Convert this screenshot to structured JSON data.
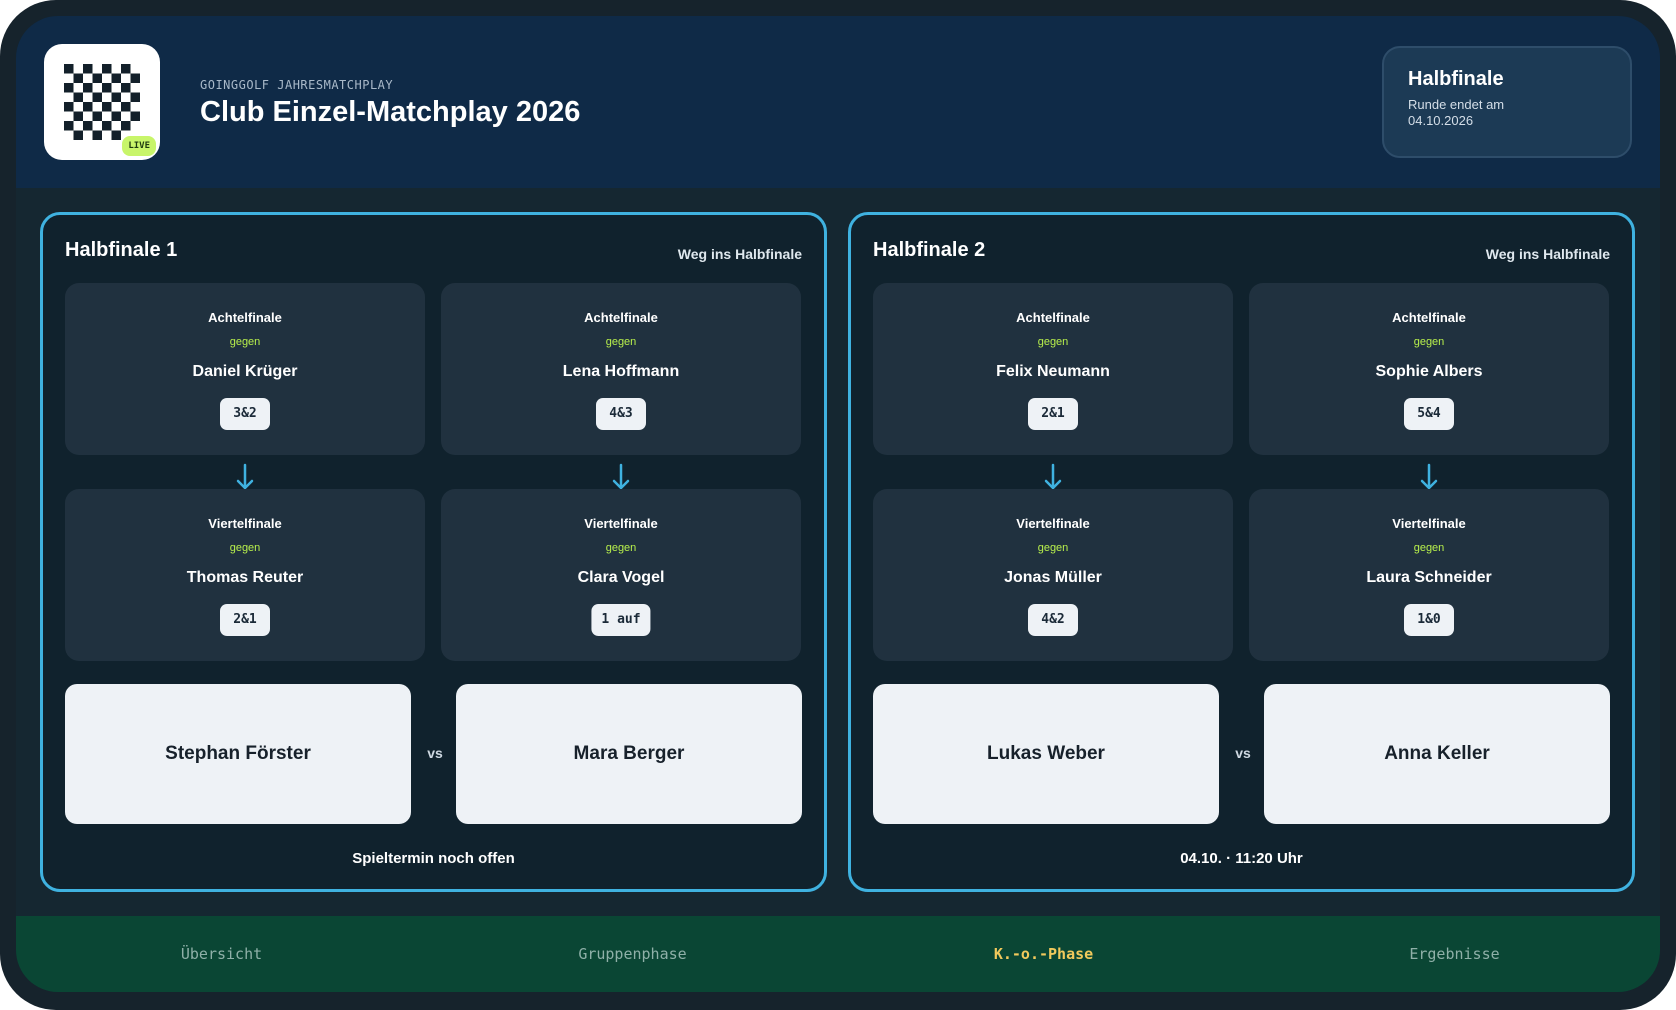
{
  "header": {
    "eyebrow": "GOINGGOLF JAHRESMATCHPLAY",
    "title": "Club Einzel-Matchplay 2026",
    "live_badge": "LIVE",
    "round": {
      "title": "Halbfinale",
      "subtitle": "Runde endet am 04.10.2026"
    }
  },
  "panels": [
    {
      "title": "Halbfinale 1",
      "subtitle": "Weg ins Halbfinale",
      "matches": [
        {
          "stage": "Achtelfinale",
          "vs_word": "gegen",
          "opponent": "Daniel Krüger",
          "score": "3&2"
        },
        {
          "stage": "Achtelfinale",
          "vs_word": "gegen",
          "opponent": "Lena Hoffmann",
          "score": "4&3"
        },
        {
          "stage": "Viertelfinale",
          "vs_word": "gegen",
          "opponent": "Thomas Reuter",
          "score": "2&1"
        },
        {
          "stage": "Viertelfinale",
          "vs_word": "gegen",
          "opponent": "Clara Vogel",
          "score": "1 auf"
        }
      ],
      "player_left": "Stephan Förster",
      "versus": "vs",
      "player_right": "Mara Berger",
      "schedule": "Spieltermin noch offen"
    },
    {
      "title": "Halbfinale 2",
      "subtitle": "Weg ins Halbfinale",
      "matches": [
        {
          "stage": "Achtelfinale",
          "vs_word": "gegen",
          "opponent": "Felix Neumann",
          "score": "2&1"
        },
        {
          "stage": "Achtelfinale",
          "vs_word": "gegen",
          "opponent": "Sophie Albers",
          "score": "5&4"
        },
        {
          "stage": "Viertelfinale",
          "vs_word": "gegen",
          "opponent": "Jonas Müller",
          "score": "4&2"
        },
        {
          "stage": "Viertelfinale",
          "vs_word": "gegen",
          "opponent": "Laura Schneider",
          "score": "1&0"
        }
      ],
      "player_left": "Lukas Weber",
      "versus": "vs",
      "player_right": "Anna Keller",
      "schedule": "04.10. · 11:20 Uhr"
    }
  ],
  "nav": {
    "items": [
      {
        "label": "Übersicht"
      },
      {
        "label": "Gruppenphase"
      },
      {
        "label": "K.-o.-Phase"
      },
      {
        "label": "Ergebnisse"
      }
    ],
    "active": "K.-o.-Phase"
  },
  "colors": {
    "accent": "#3fb2e0",
    "highlight": "#b8f04c",
    "nav_active": "#f2c95c",
    "nav_bg": "#0a4634",
    "header_bg": "#0f2a47"
  },
  "icons": [
    "checkered-flag-logo-icon",
    "arrow-down-icon"
  ]
}
